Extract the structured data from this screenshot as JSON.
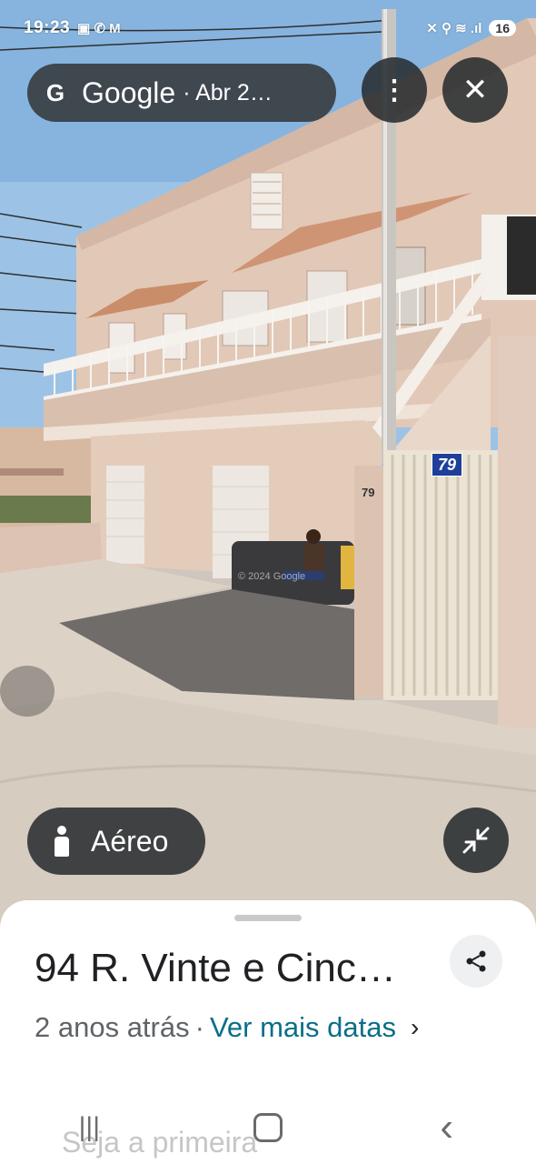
{
  "status_bar": {
    "time": "19:23",
    "left_icons": "▣ ✆ M",
    "right_icons": "✕ ⚲ ≋ .ıl",
    "battery": "16"
  },
  "top_bar": {
    "logo": "G",
    "brand": "Google",
    "date_label": "· Abr 2…",
    "menu_icon": "more-vert-icon",
    "close_icon": "close-icon"
  },
  "scene": {
    "gate_number": "79",
    "pillar_number": "79",
    "watermark": "© 2024 Google"
  },
  "bottom_controls": {
    "aereo_label": "Aéreo",
    "aereo_icon": "person-icon",
    "collapse_icon": "collapse-icon"
  },
  "sheet": {
    "address": "94 R. Vinte e Cinc…",
    "age": "2 anos atrás",
    "separator": "·",
    "more_dates": "Ver mais datas",
    "chevron": "›",
    "share_icon": "share-icon",
    "faded_text": "Seja a primeira"
  },
  "nav_bar": {
    "recents": "|||",
    "back": "‹"
  },
  "colors": {
    "link": "#0b6e88",
    "overlay": "#3a3e42",
    "sheet": "#ffffff"
  }
}
